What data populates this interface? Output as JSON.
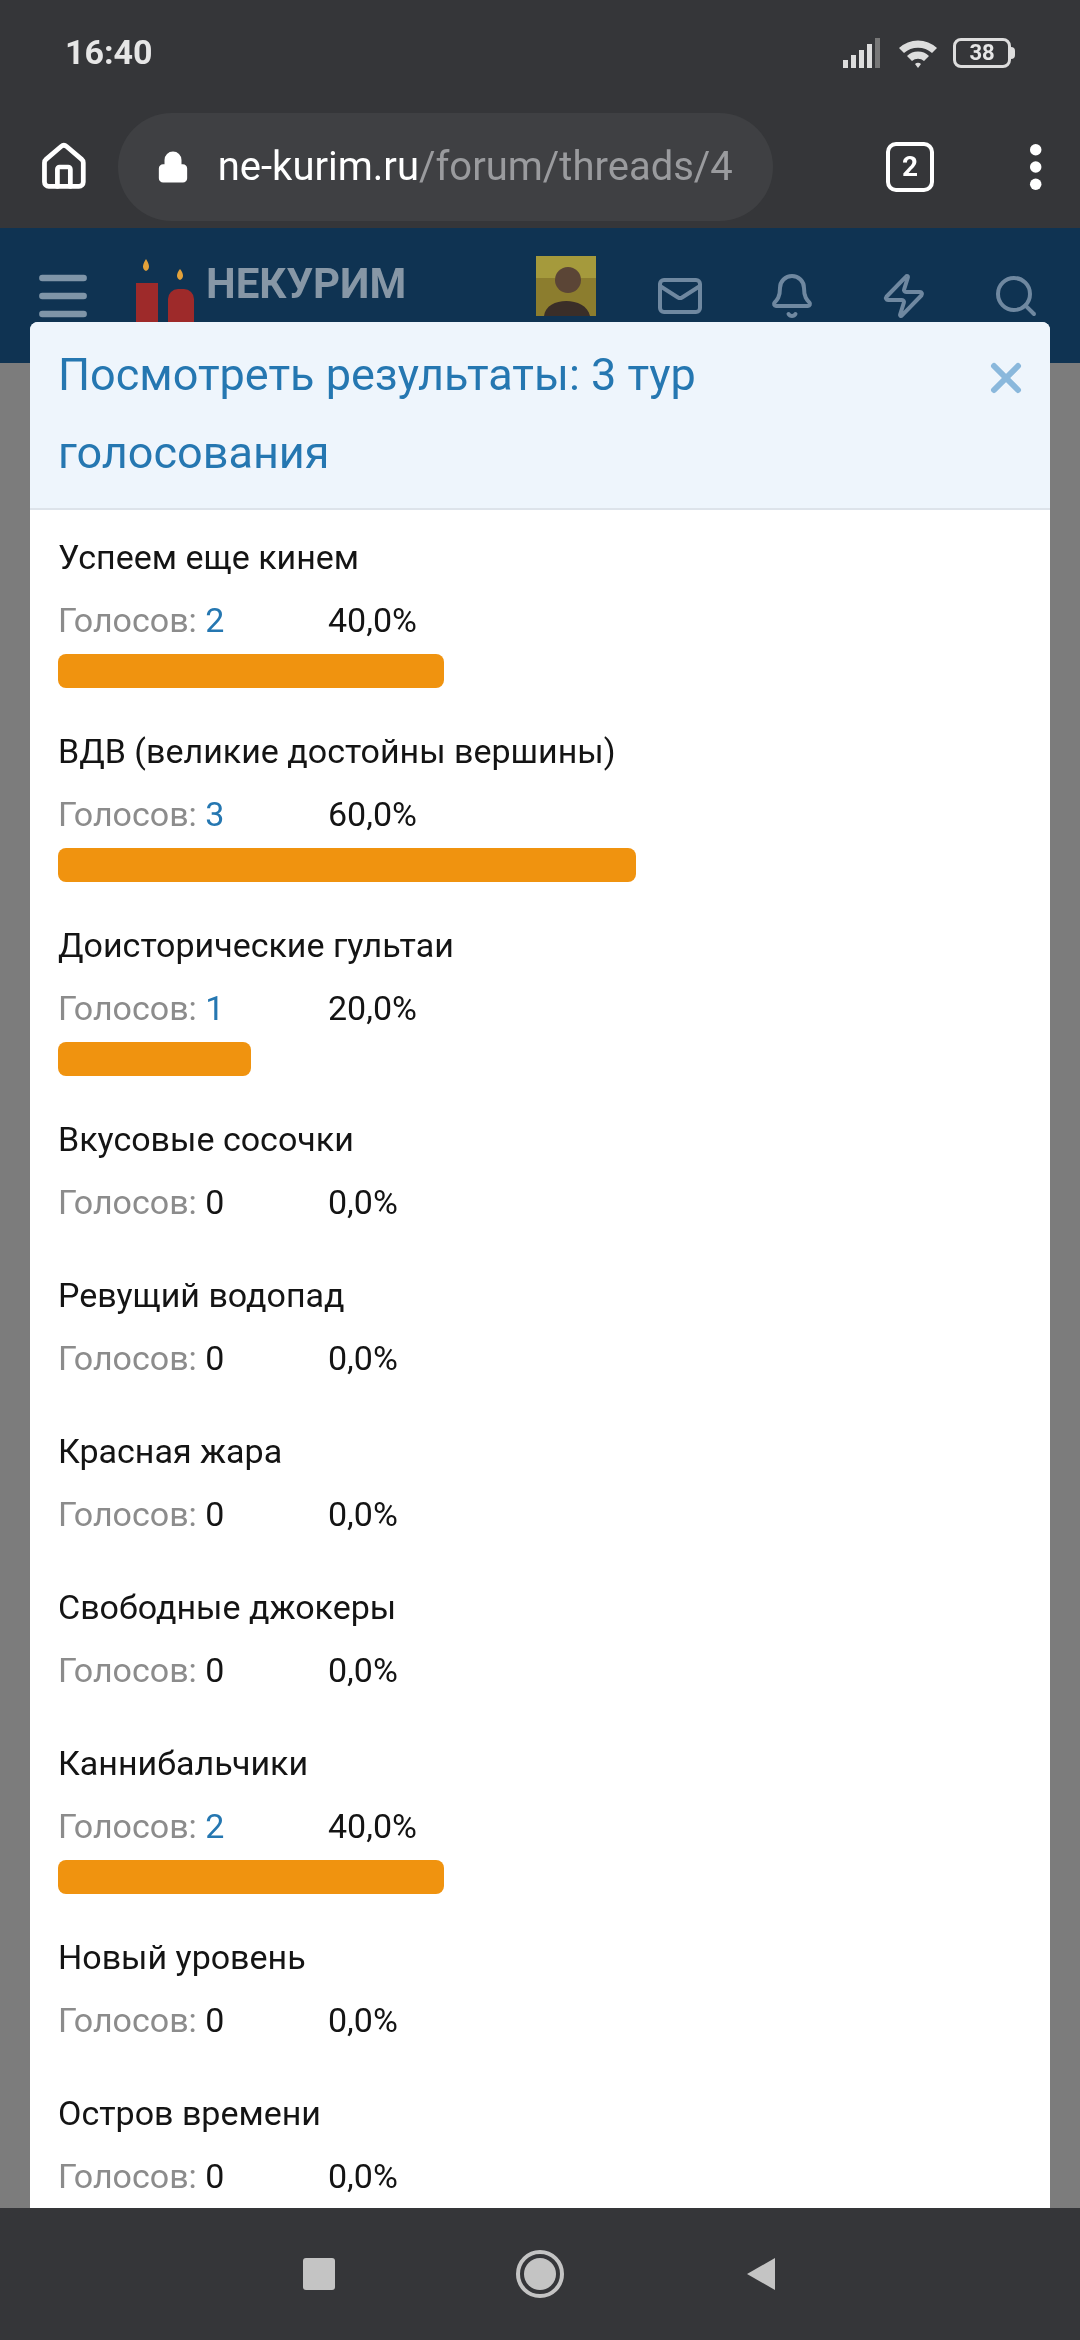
{
  "status_bar": {
    "time": "16:40",
    "battery": "38"
  },
  "browser": {
    "url_domain": "ne-kurim.ru",
    "url_path": "/forum/threads/4",
    "tab_count": "2"
  },
  "forum_header": {
    "logo_text": "НЕКУРИМ"
  },
  "dialog": {
    "title": "Посмотреть результаты: 3 тур голосования",
    "options": [
      {
        "name": "Успеем еще кинем",
        "votes_label": "Голосов:",
        "votes": "2",
        "link": true,
        "percent": "40,0%"
      },
      {
        "name": "ВДВ (великие достойны вершины)",
        "votes_label": "Голосов:",
        "votes": "3",
        "link": true,
        "percent": "60,0%"
      },
      {
        "name": "Доисторические гультаи",
        "votes_label": "Голосов:",
        "votes": "1",
        "link": true,
        "percent": "20,0%"
      },
      {
        "name": "Вкусовые сосочки",
        "votes_label": "Голосов:",
        "votes": "0",
        "link": false,
        "percent": "0,0%"
      },
      {
        "name": "Ревущий водопад",
        "votes_label": "Голосов:",
        "votes": "0",
        "link": false,
        "percent": "0,0%"
      },
      {
        "name": "Красная жара",
        "votes_label": "Голосов:",
        "votes": "0",
        "link": false,
        "percent": "0,0%"
      },
      {
        "name": "Свободные джокеры",
        "votes_label": "Голосов:",
        "votes": "0",
        "link": false,
        "percent": "0,0%"
      },
      {
        "name": "Каннибальчики",
        "votes_label": "Голосов:",
        "votes": "2",
        "link": true,
        "percent": "40,0%"
      },
      {
        "name": "Новый уровень",
        "votes_label": "Голосов:",
        "votes": "0",
        "link": false,
        "percent": "0,0%"
      },
      {
        "name": "Остров времени",
        "votes_label": "Голосов:",
        "votes": "0",
        "link": false,
        "percent": "0,0%"
      }
    ]
  }
}
